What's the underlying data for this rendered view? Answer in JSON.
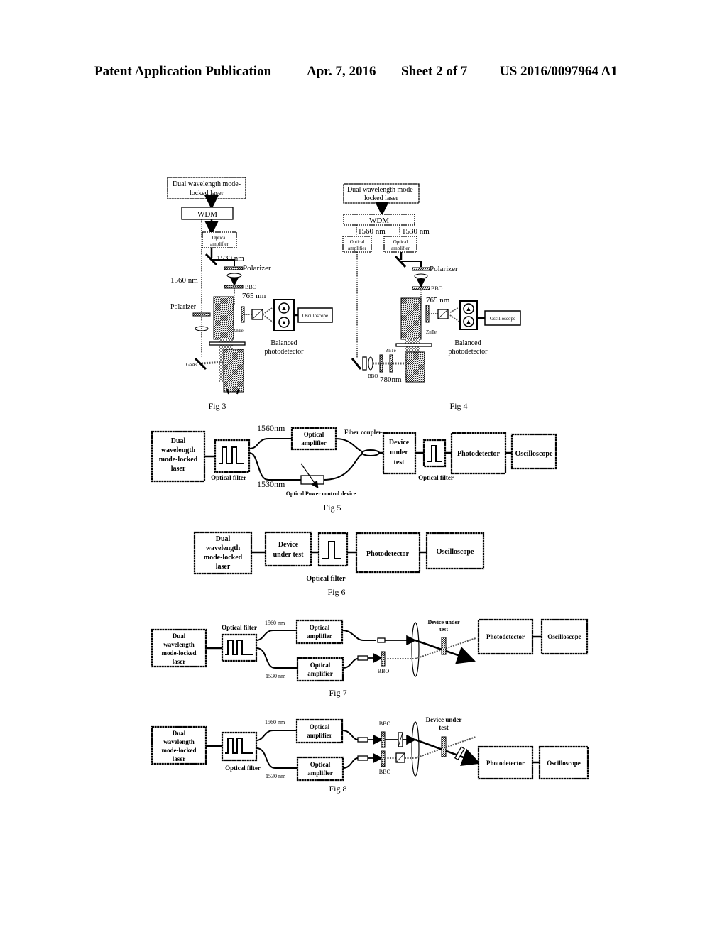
{
  "header": {
    "left": "Patent Application Publication",
    "date": "Apr. 7, 2016",
    "sheet": "Sheet 2 of 7",
    "number": "US 2016/0097964 A1"
  },
  "fig3": {
    "caption": "Fig 3",
    "laser_line1": "Dual wavelength mode-",
    "laser_line2": "locked laser",
    "wdm": "WDM",
    "amp_line1": "Optical",
    "amp_line2": "amplifier",
    "wl_1530": "1530 nm",
    "wl_1560": "1560 nm",
    "polarizer_top": "Polarizer",
    "polarizer_left": "Polarizer",
    "bbo": "BBO",
    "wl_765": "765 nm",
    "znte": "ZnTe",
    "gaas": "GaAs",
    "oscilloscope": "Oscilloscope",
    "bpd_line1": "Balanced",
    "bpd_line2": "photodetector"
  },
  "fig4": {
    "caption": "Fig 4",
    "laser_line1": "Dual wavelength mode-",
    "laser_line2": "locked laser",
    "wdm": "WDM",
    "wl_1560": "1560 nm",
    "wl_1530": "1530 nm",
    "amp_line1": "Optical",
    "amp_line2": "amplifier",
    "polarizer": "Polarizer",
    "bbo_top": "BBO",
    "wl_765": "765 nm",
    "znte_right": "ZnTe",
    "znte_bottom": "ZnTe",
    "bbo_bottom": "BBO",
    "wl_780": "780nm",
    "oscilloscope": "Oscilloscope",
    "bpd_line1": "Balanced",
    "bpd_line2": "photodetector"
  },
  "fig5": {
    "caption": "Fig 5",
    "laser": [
      "Dual",
      "wavelength",
      "mode-locked",
      "laser"
    ],
    "filter": "Optical filter",
    "wl_1560": "1560nm",
    "wl_1530": "1530nm",
    "amp_line1": "Optical",
    "amp_line2": "amplifier",
    "coupler": "Fiber coupler",
    "power_control": "Optical Power control device",
    "dut": [
      "Device",
      "under",
      "test"
    ],
    "filter2": "Optical filter",
    "photodetector": "Photodetector",
    "oscilloscope": "Oscilloscope"
  },
  "fig6": {
    "caption": "Fig 6",
    "laser": [
      "Dual",
      "wavelength",
      "mode-locked",
      "laser"
    ],
    "dut": [
      "Device",
      "under test"
    ],
    "filter": "Optical filter",
    "photodetector": "Photodetector",
    "oscilloscope": "Oscilloscope"
  },
  "fig7": {
    "caption": "Fig 7",
    "laser": [
      "Dual",
      "wavelength",
      "mode-locked",
      "laser"
    ],
    "filter": "Optical filter",
    "wl_1560": "1560   nm",
    "wl_1530": "1530   nm",
    "amp_line1": "Optical",
    "amp_line2": "amplifier",
    "bbo": "BBO",
    "dut": [
      "Device under",
      "test"
    ],
    "photodetector": "Photodetector",
    "oscilloscope": "Oscilloscope"
  },
  "fig8": {
    "caption": "Fig 8",
    "laser": [
      "Dual",
      "wavelength",
      "mode-locked",
      "laser"
    ],
    "filter": "Optical filter",
    "wl_1560": "1560   nm",
    "wl_1530": "1530   nm",
    "amp_line1": "Optical",
    "amp_line2": "amplifier",
    "bbo_top": "BBO",
    "bbo_bottom": "BBO",
    "dut": [
      "Device under",
      "test"
    ],
    "photodetector": "Photodetector",
    "oscilloscope": "Oscilloscope"
  }
}
